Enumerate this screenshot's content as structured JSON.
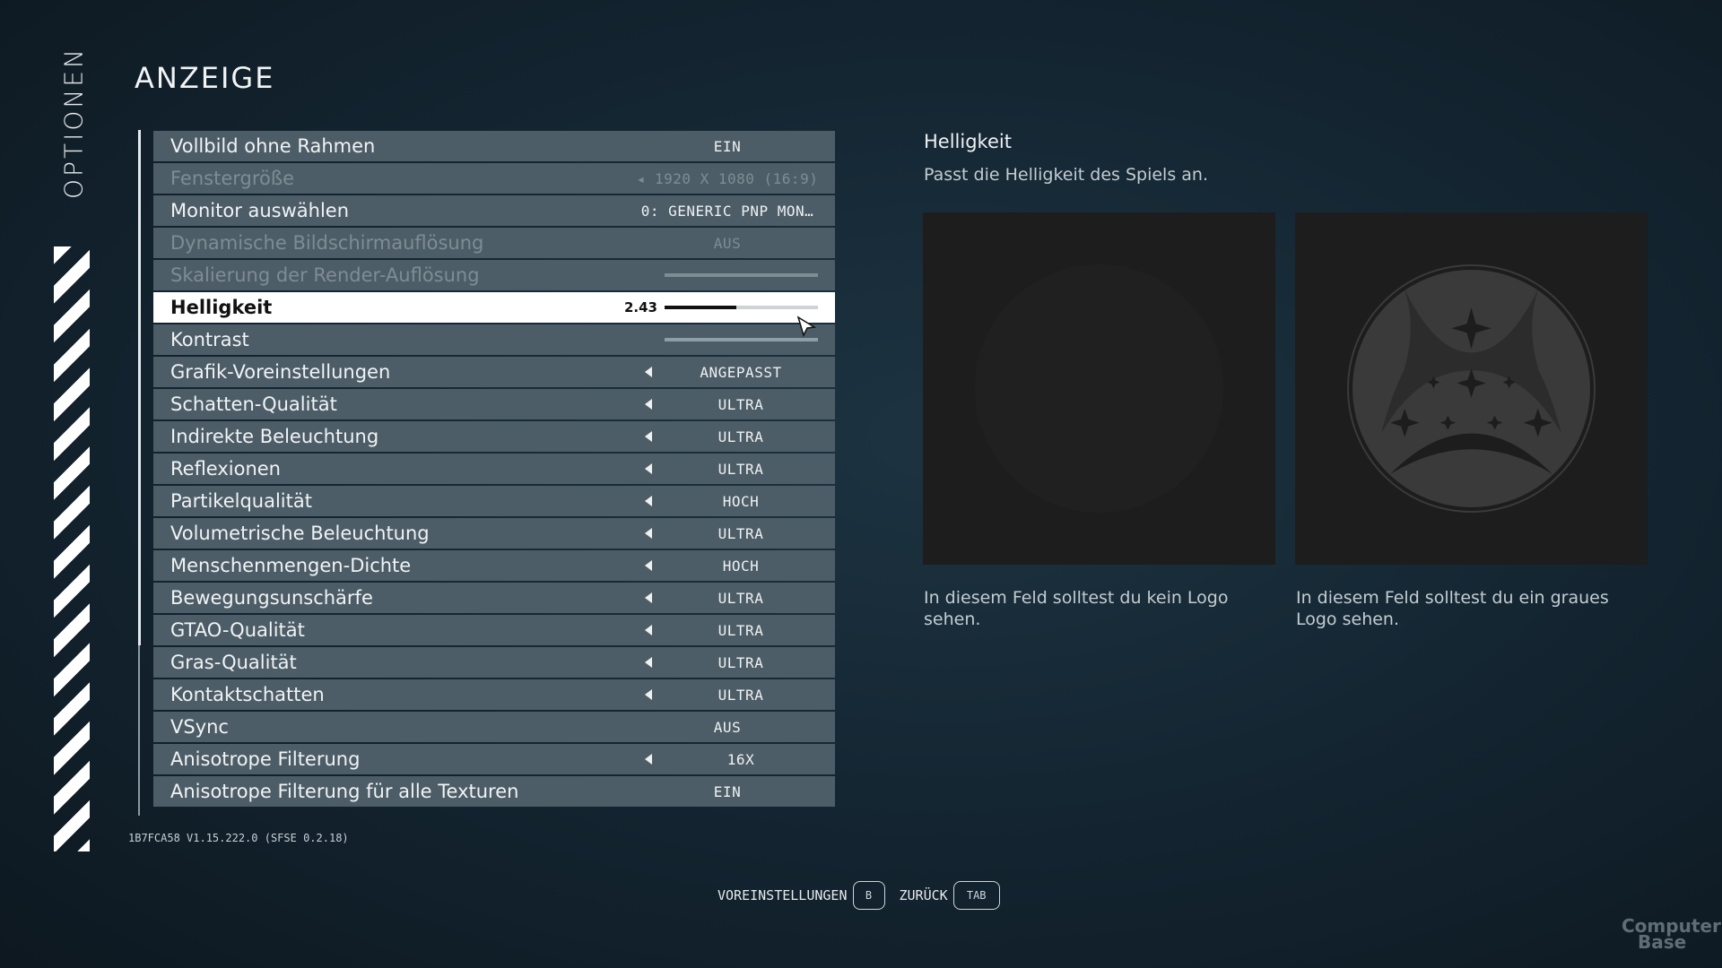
{
  "sidebar": {
    "title": "OPTIONEN"
  },
  "header": {
    "title": "ANZEIGE"
  },
  "menu": {
    "items": [
      {
        "label": "Vollbild ohne Rahmen",
        "value": "EIN"
      },
      {
        "label": "Fenstergröße",
        "value": "1920 X 1080 (16:9)"
      },
      {
        "label": "Monitor auswählen",
        "value": "0: GENERIC PNP MON…"
      },
      {
        "label": "Dynamische Bildschirmauflösung",
        "value": "AUS"
      },
      {
        "label": "Skalierung der Render-Auflösung"
      },
      {
        "label": "Helligkeit",
        "value": "2.43",
        "level": 0.47
      },
      {
        "label": "Kontrast"
      },
      {
        "label": "Grafik-Voreinstellungen",
        "value": "ANGEPASST"
      },
      {
        "label": "Schatten-Qualität",
        "value": "ULTRA"
      },
      {
        "label": "Indirekte Beleuchtung",
        "value": "ULTRA"
      },
      {
        "label": "Reflexionen",
        "value": "ULTRA"
      },
      {
        "label": "Partikelqualität",
        "value": "HOCH"
      },
      {
        "label": "Volumetrische Beleuchtung",
        "value": "ULTRA"
      },
      {
        "label": "Menschenmengen-Dichte",
        "value": "HOCH"
      },
      {
        "label": "Bewegungsunschärfe",
        "value": "ULTRA"
      },
      {
        "label": "GTAO-Qualität",
        "value": "ULTRA"
      },
      {
        "label": "Gras-Qualität",
        "value": "ULTRA"
      },
      {
        "label": "Kontaktschatten",
        "value": "ULTRA"
      },
      {
        "label": "VSync",
        "value": "AUS"
      },
      {
        "label": "Anisotrope Filterung",
        "value": "16X"
      },
      {
        "label": "Anisotrope Filterung für alle Texturen",
        "value": "EIN"
      }
    ]
  },
  "version": "1B7FCA58 V1.15.222.0  (SFSE 0.2.18)",
  "detail": {
    "title": "Helligkeit",
    "description": "Passt die Helligkeit des Spiels an.",
    "caption_left": "In diesem Feld solltest du kein Logo sehen.",
    "caption_right": "In diesem Feld solltest du ein graues Logo sehen."
  },
  "footer": {
    "presets_label": "VOREINSTELLUNGEN",
    "presets_key": "B",
    "back_label": "ZURÜCK",
    "back_key": "TAB"
  },
  "watermark": {
    "line1": "Computer",
    "line2": "Base"
  },
  "colors": {
    "background": "#132430",
    "row": "#4d5d67",
    "selected_row": "#ffffff",
    "disabled_text": "#7e8c94",
    "panel": "#1d1d1d",
    "logo_gray": "#3a3a3a"
  }
}
